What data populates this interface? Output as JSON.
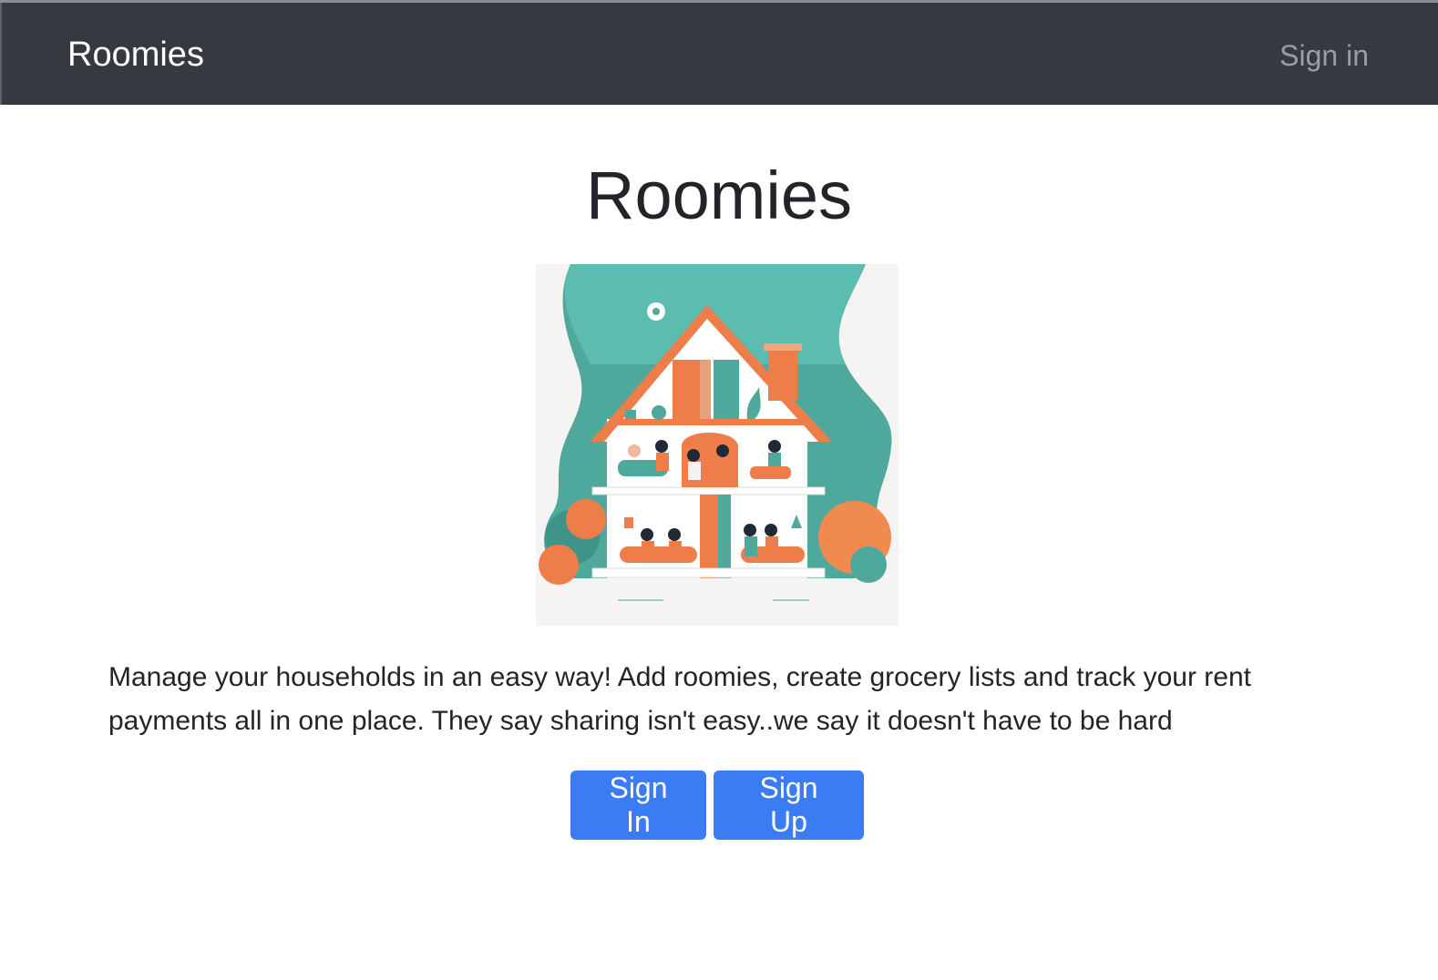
{
  "navbar": {
    "brand": "Roomies",
    "sign_in_link": "Sign in"
  },
  "main": {
    "title": "Roomies",
    "hero_image": {
      "icon": "house-illustration"
    },
    "description": "Manage your households in an easy way! Add roomies, create grocery lists and track your rent payments all in one place. They say sharing isn't easy..we say it doesn't have to be hard",
    "buttons": {
      "sign_in": "Sign In",
      "sign_up": "Sign Up"
    }
  },
  "colors": {
    "navbar_bg": "#343a40",
    "primary_button": "#3b7cf5",
    "illustration_teal": "#4fa89c",
    "illustration_orange": "#ef7d4a"
  }
}
